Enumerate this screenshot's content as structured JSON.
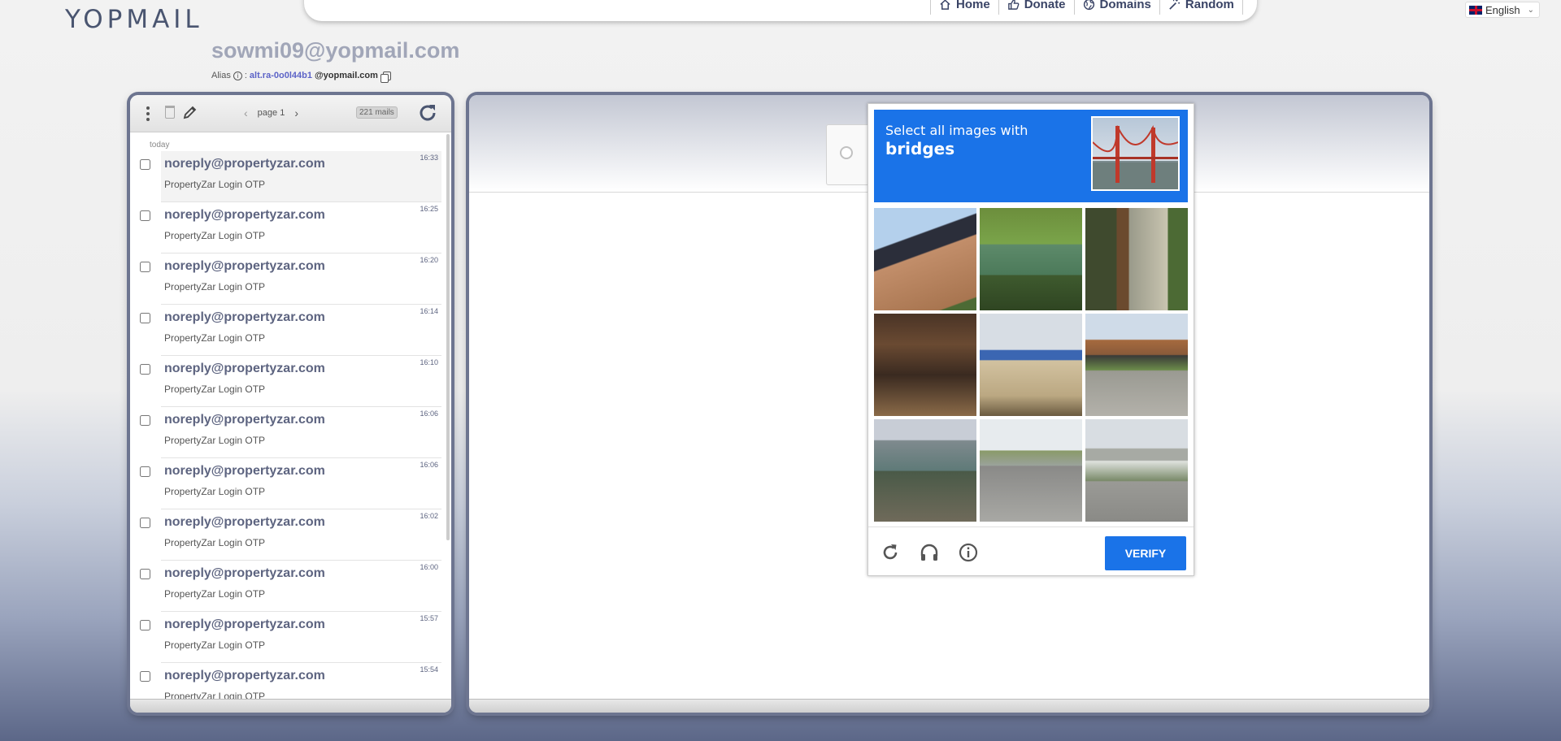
{
  "logo": {
    "text": "YOPMAIL"
  },
  "nav": [
    {
      "label": "Home",
      "icon": "home-icon"
    },
    {
      "label": "Donate",
      "icon": "thumbs-up-icon"
    },
    {
      "label": "Domains",
      "icon": "globe-icon"
    },
    {
      "label": "Random",
      "icon": "magic-wand-icon"
    }
  ],
  "language": {
    "selected": "English"
  },
  "mailbox": {
    "address": "sowmi09@yopmail.com",
    "alias_label": "Alias",
    "alias_sep": ":",
    "alias_name": "alt.ra-0o0l44b1",
    "alias_domain": "@yopmail.com"
  },
  "toolbar": {
    "page": "page 1",
    "count": "221 mails"
  },
  "inbox": {
    "day": "today",
    "emails": [
      {
        "from": "noreply@propertyzar.com",
        "subject": "PropertyZar Login OTP",
        "time": "16:33"
      },
      {
        "from": "noreply@propertyzar.com",
        "subject": "PropertyZar Login OTP",
        "time": "16:25"
      },
      {
        "from": "noreply@propertyzar.com",
        "subject": "PropertyZar Login OTP",
        "time": "16:20"
      },
      {
        "from": "noreply@propertyzar.com",
        "subject": "PropertyZar Login OTP",
        "time": "16:14"
      },
      {
        "from": "noreply@propertyzar.com",
        "subject": "PropertyZar Login OTP",
        "time": "16:10"
      },
      {
        "from": "noreply@propertyzar.com",
        "subject": "PropertyZar Login OTP",
        "time": "16:06"
      },
      {
        "from": "noreply@propertyzar.com",
        "subject": "PropertyZar Login OTP",
        "time": "16:06"
      },
      {
        "from": "noreply@propertyzar.com",
        "subject": "PropertyZar Login OTP",
        "time": "16:02"
      },
      {
        "from": "noreply@propertyzar.com",
        "subject": "PropertyZar Login OTP",
        "time": "16:00"
      },
      {
        "from": "noreply@propertyzar.com",
        "subject": "PropertyZar Login OTP",
        "time": "15:57"
      },
      {
        "from": "noreply@propertyzar.com",
        "subject": "PropertyZar Login OTP",
        "time": "15:54"
      }
    ]
  },
  "captcha": {
    "instruction": "Select all images with",
    "target": "bridges",
    "verify_label": "VERIFY",
    "tiles": [
      "roof with solar panel",
      "green house with trees",
      "rusty pole by building",
      "wooden shed",
      "house with water tower",
      "road under overpass bridge",
      "boat on shore",
      "road with truck",
      "highway overpass bridge"
    ]
  },
  "colors": {
    "accent": "#1a73e8",
    "sender": "#5d6480",
    "alias_link": "#5c63c7"
  }
}
